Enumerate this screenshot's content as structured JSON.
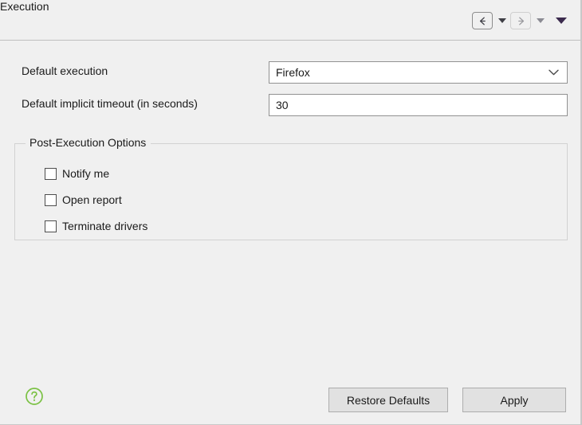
{
  "window": {
    "title": "Execution",
    "background_color": "#f0f0f0"
  },
  "header": {
    "title": "Execution",
    "nav": {
      "back_icon": "arrow-left-icon",
      "back_dropdown_icon": "caret-down-icon",
      "forward_icon": "arrow-right-icon",
      "forward_dropdown_icon": "caret-down-icon",
      "view_menu_icon": "caret-down-icon"
    }
  },
  "form": {
    "fields": [
      {
        "label": "Default execution",
        "type": "combobox",
        "value": "Firefox",
        "chevron_icon": "chevron-down-icon"
      },
      {
        "label": "Default implicit timeout (in seconds)",
        "type": "textfield",
        "value": "30"
      }
    ]
  },
  "group": {
    "title": "Post-Execution Options",
    "checkboxes": [
      {
        "label": "Notify me",
        "checked": false
      },
      {
        "label": "Open report",
        "checked": false
      },
      {
        "label": "Terminate drivers",
        "checked": false
      }
    ]
  },
  "footer": {
    "help_icon": "help-question-circle-icon",
    "help_icon_color": "#7ac143",
    "buttons": [
      {
        "label": "Restore Defaults"
      },
      {
        "label": "Apply"
      }
    ]
  }
}
